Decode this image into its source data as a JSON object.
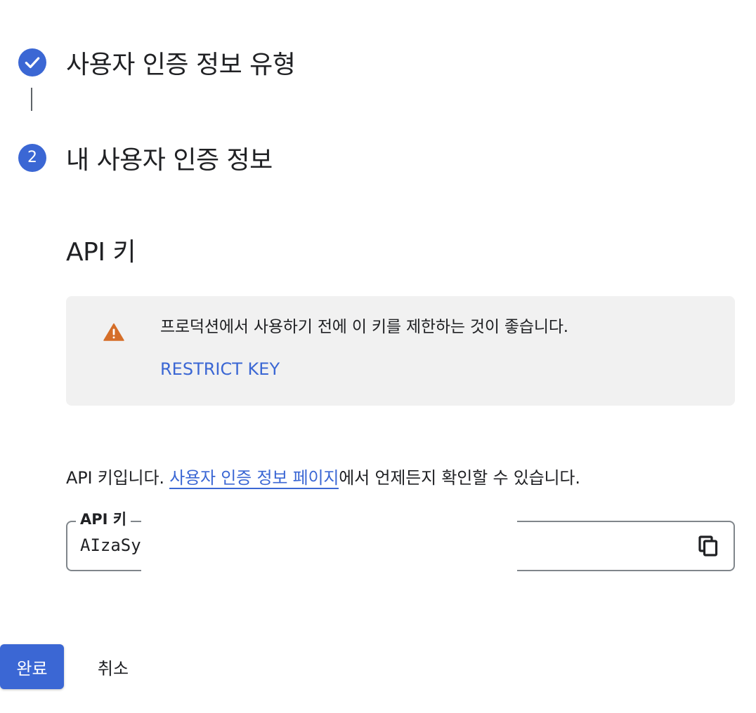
{
  "colors": {
    "accent": "#3b67d4",
    "warning": "#d56e29",
    "notice_background": "#f1f1f1",
    "text": "#202124",
    "connector": "#5f6368"
  },
  "stepper": {
    "steps": [
      {
        "title": "사용자 인증 정보 유형",
        "status": "completed",
        "icon": "check-icon"
      },
      {
        "title": "내 사용자 인증 정보",
        "status": "active",
        "number": "2"
      }
    ]
  },
  "section": {
    "title": "API 키"
  },
  "notice": {
    "icon": "warning-icon",
    "text": "프로덕션에서 사용하기 전에 이 키를 제한하는 것이 좋습니다.",
    "link_label": "RESTRICT KEY"
  },
  "info": {
    "prefix": "API 키입니다. ",
    "link_label": "사용자 인증 정보 페이지",
    "suffix": "에서 언제든지 확인할 수 있습니다."
  },
  "key_field": {
    "label": "API 키",
    "value": "AIzaSy",
    "copy_icon": "copy-icon"
  },
  "footer": {
    "done_label": "완료",
    "cancel_label": "취소"
  }
}
